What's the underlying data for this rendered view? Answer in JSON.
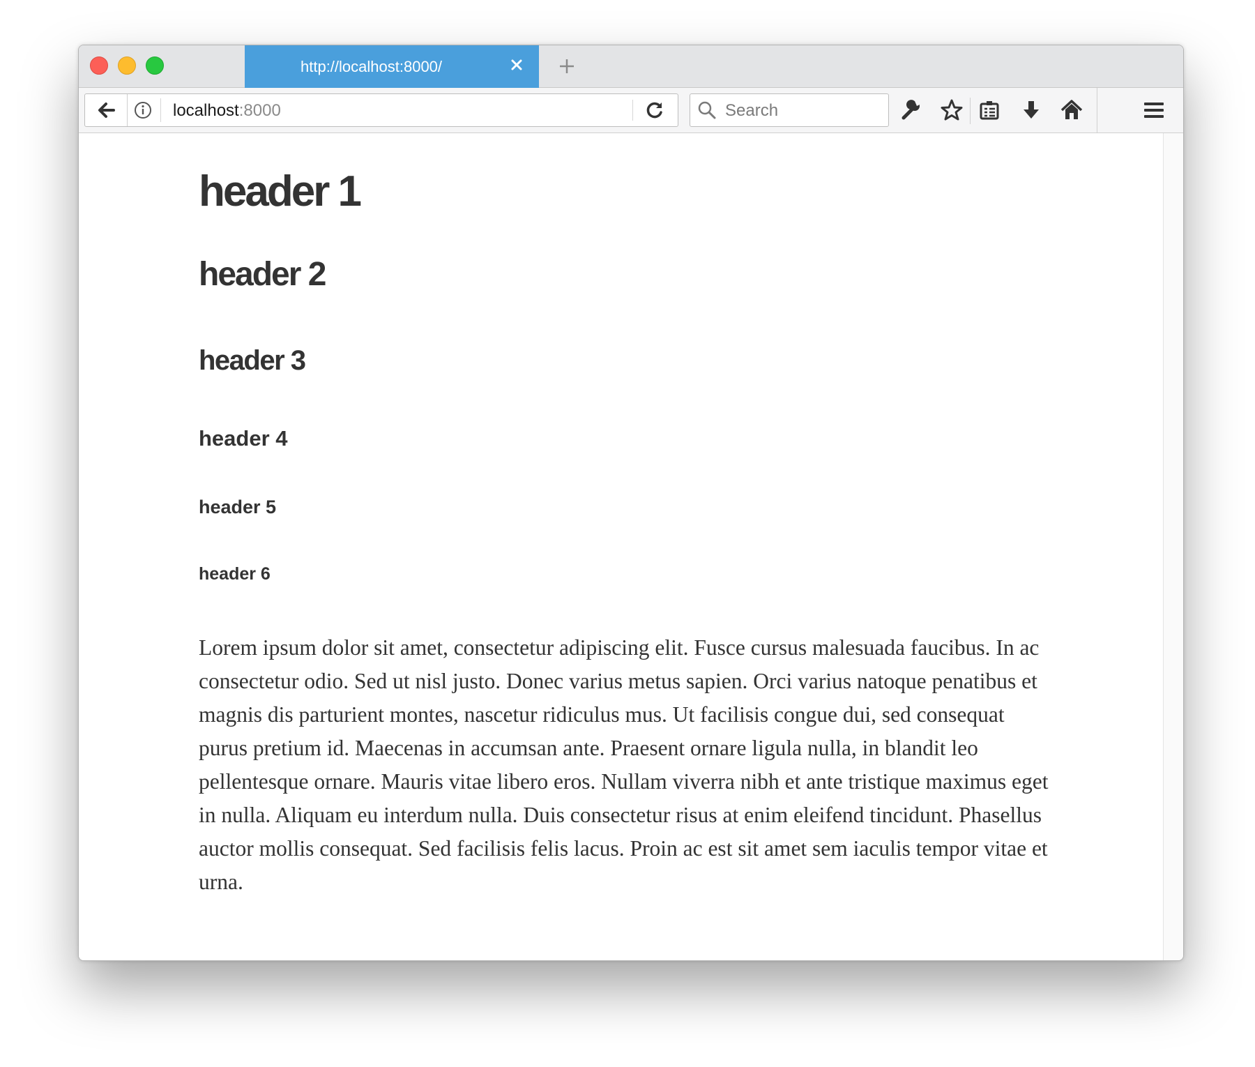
{
  "browser": {
    "tab": {
      "title": "http://localhost:8000/"
    },
    "address": {
      "host": "localhost",
      "port": ":8000"
    },
    "search": {
      "placeholder": "Search"
    },
    "colors": {
      "tab_active": "#4a9fdc",
      "chrome": "#e3e4e6",
      "toolbar": "#f5f5f6"
    },
    "icons": [
      "back-arrow-icon",
      "info-icon",
      "reload-icon",
      "search-icon",
      "wrench-icon",
      "star-icon",
      "reading-list-icon",
      "download-icon",
      "home-icon",
      "menu-icon",
      "close-icon",
      "plus-icon"
    ]
  },
  "page": {
    "headers": {
      "h1": "header 1",
      "h2": "header 2",
      "h3": "header 3",
      "h4": "header 4",
      "h5": "header 5",
      "h6": "header 6"
    },
    "paragraph": "Lorem ipsum dolor sit amet, consectetur adipiscing elit. Fusce cursus malesuada faucibus. In ac consectetur odio. Sed ut nisl justo. Donec varius metus sapien. Orci varius natoque penatibus et magnis dis parturient montes, nascetur ridiculus mus. Ut facilisis congue dui, sed consequat purus pretium id. Maecenas in accumsan ante. Praesent ornare ligula nulla, in blandit leo pellentesque ornare. Mauris vitae libero eros. Nullam viverra nibh et ante tristique maximus eget in nulla. Aliquam eu interdum nulla. Duis consectetur risus at enim eleifend tincidunt. Phasellus auctor mollis consequat. Sed facilisis felis lacus. Proin ac est sit amet sem iaculis tempor vitae et urna."
  }
}
